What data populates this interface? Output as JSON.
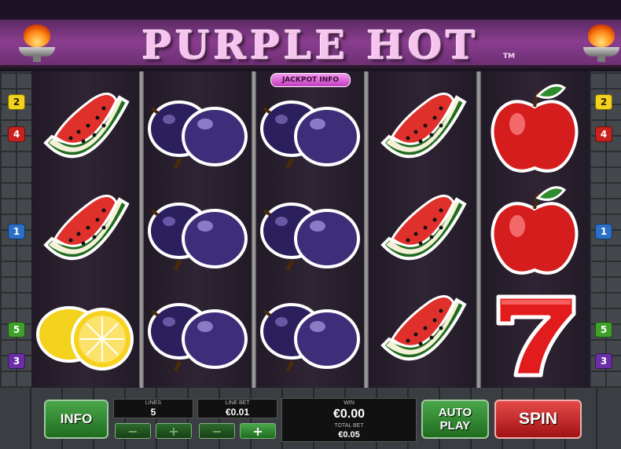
{
  "game": {
    "title": "PURPLE HOT",
    "trademark": "TM"
  },
  "jackpot_info_label": "JACKPOT INFO",
  "paylines_left": [
    "2",
    "4",
    "1",
    "5",
    "3"
  ],
  "paylines_right": [
    "2",
    "4",
    "1",
    "5",
    "3"
  ],
  "reels": [
    [
      "watermelon",
      "watermelon",
      "lemon"
    ],
    [
      "plum",
      "plum",
      "plum"
    ],
    [
      "plum",
      "plum",
      "plum"
    ],
    [
      "watermelon",
      "watermelon",
      "watermelon"
    ],
    [
      "apple",
      "apple",
      "seven"
    ]
  ],
  "controls": {
    "info_label": "INFO",
    "lines": {
      "label": "LINES",
      "value": "5",
      "minus": "−",
      "plus": "+"
    },
    "line_bet": {
      "label": "LINE BET",
      "value": "€0.01",
      "minus": "−",
      "plus": "+"
    },
    "win": {
      "label": "WIN",
      "value": "€0.00"
    },
    "total_bet": {
      "label": "TOTAL BET",
      "value": "€0.05"
    },
    "autoplay_line1": "AUTO",
    "autoplay_line2": "PLAY",
    "spin_label": "SPIN"
  },
  "colors": {
    "header_purple": "#8a3d8f",
    "title_pink": "#f7c3ef",
    "button_green": "#1f6d1f",
    "button_red": "#a11212"
  }
}
